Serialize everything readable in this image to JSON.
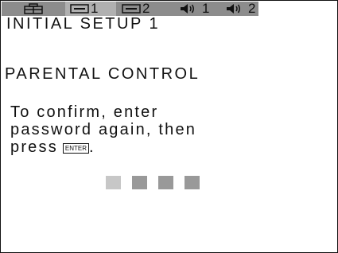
{
  "status_bar": {
    "tabs": [
      {
        "icon": "setup-toolbox-icon",
        "label": ""
      },
      {
        "icon": "subtitle-icon",
        "label": "1"
      },
      {
        "icon": "subtitle-icon",
        "label": "2"
      },
      {
        "icon": "speaker-icon",
        "label": "1"
      },
      {
        "icon": "speaker-icon",
        "label": "2"
      }
    ],
    "selected_tab_index": 1
  },
  "screen": {
    "title": "INITIAL SETUP 1",
    "section": "PARENTAL CONTROL",
    "message": {
      "line1": "To confirm, enter",
      "line2": "password again, then",
      "line3": "press",
      "key_label": "ENTER",
      "line3_end": "."
    }
  },
  "password_entry": {
    "digits": 4,
    "filled": 0,
    "colors": {
      "active": "#c7c7c7",
      "inactive": "#999999"
    }
  }
}
